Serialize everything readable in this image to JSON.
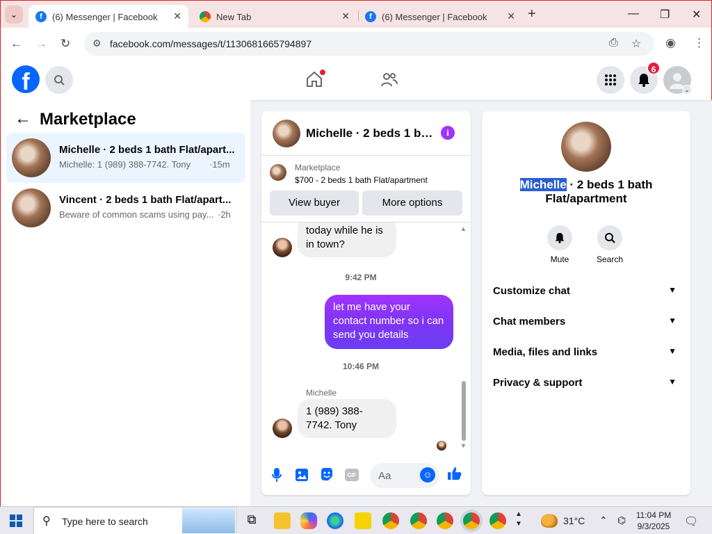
{
  "browser": {
    "tabs": [
      {
        "title": "(6) Messenger | Facebook",
        "active": true
      },
      {
        "title": "New Tab",
        "active": false
      },
      {
        "title": "(6) Messenger | Facebook",
        "active": false
      }
    ],
    "url": "facebook.com/messages/t/1130681665794897"
  },
  "header": {
    "notification_count": "6"
  },
  "left_panel": {
    "title": "Marketplace",
    "conversations": [
      {
        "name": "Michelle · 2 beds 1 bath Flat/apart...",
        "snippet": "Michelle: 1 (989) 388-7742. Tony",
        "time": "·15m",
        "selected": true
      },
      {
        "name": "Vincent · 2 beds 1 bath Flat/apart...",
        "snippet": "Beware of common scams using pay...",
        "time": "·2h",
        "selected": false
      }
    ]
  },
  "chat": {
    "title": "Michelle · 2 beds 1 bath Flat/apartment",
    "marketplace_label": "Marketplace",
    "listing": "$700 - 2 beds 1 bath Flat/apartment",
    "view_buyer": "View buyer",
    "more_options": "More options",
    "messages": [
      {
        "type": "in",
        "text": "today while he is in town?"
      },
      {
        "type": "timestamp",
        "text": "9:42 PM"
      },
      {
        "type": "out",
        "text": "let me have your contact number so i can send you details"
      },
      {
        "type": "timestamp",
        "text": "10:46 PM"
      },
      {
        "type": "sender",
        "text": "Michelle"
      },
      {
        "type": "in",
        "text": "1 (989) 388-7742. Tony"
      }
    ],
    "composer_placeholder": "Aa",
    "gif_label": "GIF"
  },
  "right_panel": {
    "title_highlight": "Michelle",
    "title_rest": " · 2 beds 1 bath Flat/apartment",
    "actions": [
      {
        "label": "Mute",
        "icon": "bell-icon"
      },
      {
        "label": "Search",
        "icon": "search-icon"
      }
    ],
    "sections": [
      {
        "label": "Customize chat"
      },
      {
        "label": "Chat members"
      },
      {
        "label": "Media, files and links"
      },
      {
        "label": "Privacy & support"
      }
    ]
  },
  "taskbar": {
    "search_placeholder": "Type here to search",
    "temperature": "31°C",
    "time": "11:04 PM",
    "date": "9/3/2025"
  },
  "colors": {
    "facebook_blue": "#0866ff",
    "messenger_purple": "#a033ff",
    "badge_red": "#e41e3f"
  }
}
